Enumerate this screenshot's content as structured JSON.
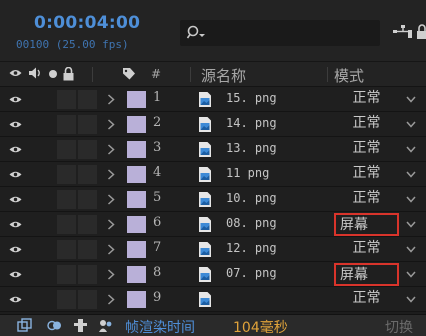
{
  "timeline": {
    "timecode": "0:00:04:00",
    "frame_info": "00100 (25.00 fps)",
    "search": {
      "value": ""
    }
  },
  "header": {
    "col_hash": "#",
    "col_source": "源名称",
    "col_mode": "模式"
  },
  "layers": [
    {
      "num": "1",
      "name": "15. png",
      "mode": "正常",
      "highlight": false
    },
    {
      "num": "2",
      "name": "14. png",
      "mode": "正常",
      "highlight": false
    },
    {
      "num": "3",
      "name": "13. png",
      "mode": "正常",
      "highlight": false
    },
    {
      "num": "4",
      "name": "11 png",
      "mode": "正常",
      "highlight": false
    },
    {
      "num": "5",
      "name": "10. png",
      "mode": "正常",
      "highlight": false
    },
    {
      "num": "6",
      "name": "08. png",
      "mode": "屏幕",
      "highlight": true
    },
    {
      "num": "7",
      "name": "12. png",
      "mode": "正常",
      "highlight": false
    },
    {
      "num": "8",
      "name": "07. png",
      "mode": "屏幕",
      "highlight": true
    },
    {
      "num": "9",
      "name": "",
      "mode": "正常",
      "highlight": false
    }
  ],
  "footer": {
    "render_label": "帧渲染时间",
    "render_value": "104毫秒",
    "toggle_label": "切换"
  },
  "colors": {
    "timecode": "#4e8fd8",
    "label_swatch": "#b9b0d8",
    "highlight_border": "#d9342b"
  }
}
